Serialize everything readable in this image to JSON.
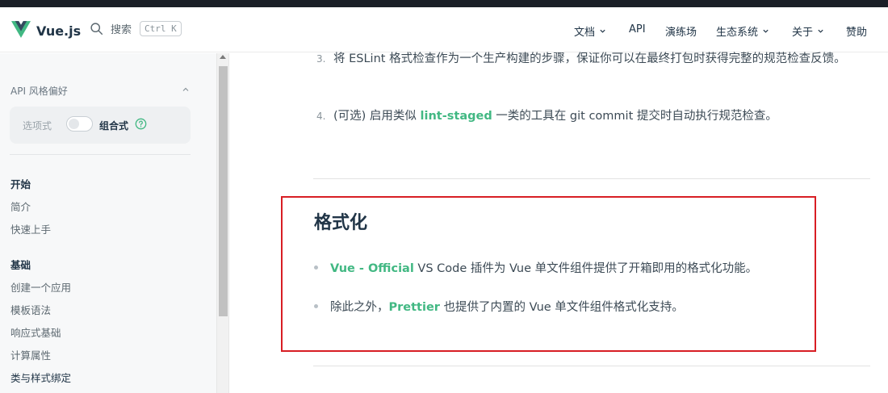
{
  "navbar": {
    "logo_text": "Vue.js",
    "search_label": "搜索",
    "search_shortcut": "Ctrl K",
    "items": [
      {
        "label": "文档",
        "has_dropdown": true
      },
      {
        "label": "API",
        "has_dropdown": false
      },
      {
        "label": "演练场",
        "has_dropdown": false
      },
      {
        "label": "生态系统",
        "has_dropdown": true
      },
      {
        "label": "关于",
        "has_dropdown": true
      },
      {
        "label": "赞助",
        "has_dropdown": false
      }
    ]
  },
  "sidebar": {
    "pref_heading": "API 风格偏好",
    "option_a": "选项式",
    "option_b": "组合式",
    "sections": [
      {
        "title": "开始",
        "links": [
          "简介",
          "快速上手"
        ]
      },
      {
        "title": "基础",
        "links": [
          "创建一个应用",
          "模板语法",
          "响应式基础",
          "计算属性",
          "类与样式绑定"
        ]
      }
    ]
  },
  "content": {
    "ol": [
      {
        "num": "3.",
        "parts": [
          "将 ESLint 格式检查作为一个生产构建的步骤，保证你可以在最终打包时获得完整的规范检查反馈。"
        ]
      },
      {
        "num": "4.",
        "pre": "(可选) 启用类似 ",
        "link": "lint-staged",
        "post": " 一类的工具在 git commit 提交时自动执行规范检查。"
      }
    ],
    "heading": "格式化",
    "ul": [
      {
        "link": "Vue - Official",
        "post": " VS Code 插件为 Vue 单文件组件提供了开箱即用的格式化功能。"
      },
      {
        "pre": "除此之外，",
        "link": "Prettier",
        "post": " 也提供了内置的 Vue 单文件组件格式化支持。"
      }
    ]
  },
  "colors": {
    "brand_green": "#42b883",
    "highlight_box": "#d81e24",
    "text_dark": "#213547"
  }
}
